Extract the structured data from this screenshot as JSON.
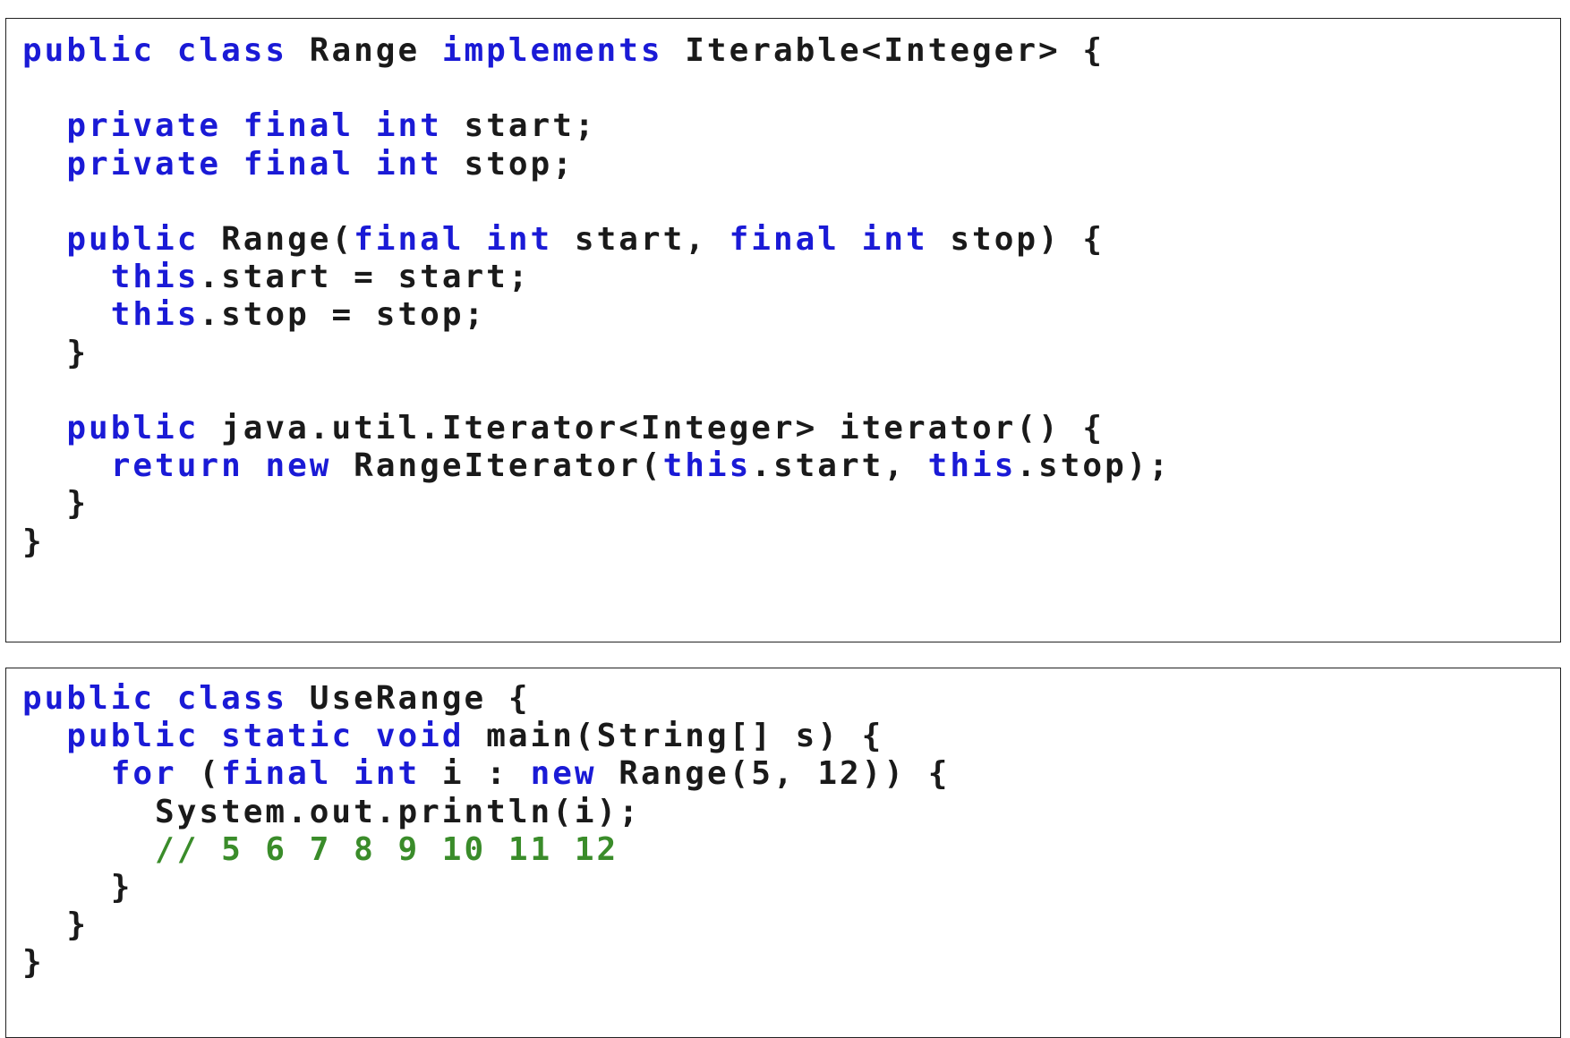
{
  "snippets": [
    {
      "lines": [
        [
          {
            "t": "kw",
            "s": "public"
          },
          {
            "t": "tx",
            "s": " "
          },
          {
            "t": "kw",
            "s": "class"
          },
          {
            "t": "tx",
            "s": " Range "
          },
          {
            "t": "kw",
            "s": "implements"
          },
          {
            "t": "tx",
            "s": " Iterable<Integer> {"
          }
        ],
        [],
        [
          {
            "t": "tx",
            "s": "  "
          },
          {
            "t": "kw",
            "s": "private"
          },
          {
            "t": "tx",
            "s": " "
          },
          {
            "t": "kw",
            "s": "final"
          },
          {
            "t": "tx",
            "s": " "
          },
          {
            "t": "kw",
            "s": "int"
          },
          {
            "t": "tx",
            "s": " start;"
          }
        ],
        [
          {
            "t": "tx",
            "s": "  "
          },
          {
            "t": "kw",
            "s": "private"
          },
          {
            "t": "tx",
            "s": " "
          },
          {
            "t": "kw",
            "s": "final"
          },
          {
            "t": "tx",
            "s": " "
          },
          {
            "t": "kw",
            "s": "int"
          },
          {
            "t": "tx",
            "s": " stop;"
          }
        ],
        [],
        [
          {
            "t": "tx",
            "s": "  "
          },
          {
            "t": "kw",
            "s": "public"
          },
          {
            "t": "tx",
            "s": " Range("
          },
          {
            "t": "kw",
            "s": "final"
          },
          {
            "t": "tx",
            "s": " "
          },
          {
            "t": "kw",
            "s": "int"
          },
          {
            "t": "tx",
            "s": " start, "
          },
          {
            "t": "kw",
            "s": "final"
          },
          {
            "t": "tx",
            "s": " "
          },
          {
            "t": "kw",
            "s": "int"
          },
          {
            "t": "tx",
            "s": " stop) {"
          }
        ],
        [
          {
            "t": "tx",
            "s": "    "
          },
          {
            "t": "kw",
            "s": "this"
          },
          {
            "t": "tx",
            "s": ".start = start;"
          }
        ],
        [
          {
            "t": "tx",
            "s": "    "
          },
          {
            "t": "kw",
            "s": "this"
          },
          {
            "t": "tx",
            "s": ".stop = stop;"
          }
        ],
        [
          {
            "t": "tx",
            "s": "  }"
          }
        ],
        [],
        [
          {
            "t": "tx",
            "s": "  "
          },
          {
            "t": "kw",
            "s": "public"
          },
          {
            "t": "tx",
            "s": " java.util.Iterator<Integer> iterator() {"
          }
        ],
        [
          {
            "t": "tx",
            "s": "    "
          },
          {
            "t": "kw",
            "s": "return"
          },
          {
            "t": "tx",
            "s": " "
          },
          {
            "t": "kw",
            "s": "new"
          },
          {
            "t": "tx",
            "s": " RangeIterator("
          },
          {
            "t": "kw",
            "s": "this"
          },
          {
            "t": "tx",
            "s": ".start, "
          },
          {
            "t": "kw",
            "s": "this"
          },
          {
            "t": "tx",
            "s": ".stop);"
          }
        ],
        [
          {
            "t": "tx",
            "s": "  }"
          }
        ],
        [
          {
            "t": "tx",
            "s": "}"
          }
        ]
      ]
    },
    {
      "lines": [
        [
          {
            "t": "kw",
            "s": "public"
          },
          {
            "t": "tx",
            "s": " "
          },
          {
            "t": "kw",
            "s": "class"
          },
          {
            "t": "tx",
            "s": " UseRange {"
          }
        ],
        [
          {
            "t": "tx",
            "s": "  "
          },
          {
            "t": "kw",
            "s": "public"
          },
          {
            "t": "tx",
            "s": " "
          },
          {
            "t": "kw",
            "s": "static"
          },
          {
            "t": "tx",
            "s": " "
          },
          {
            "t": "kw",
            "s": "void"
          },
          {
            "t": "tx",
            "s": " main(String[] s) {"
          }
        ],
        [
          {
            "t": "tx",
            "s": "    "
          },
          {
            "t": "kw",
            "s": "for"
          },
          {
            "t": "tx",
            "s": " ("
          },
          {
            "t": "kw",
            "s": "final"
          },
          {
            "t": "tx",
            "s": " "
          },
          {
            "t": "kw",
            "s": "int"
          },
          {
            "t": "tx",
            "s": " i : "
          },
          {
            "t": "kw",
            "s": "new"
          },
          {
            "t": "tx",
            "s": " Range(5, 12)) {"
          }
        ],
        [
          {
            "t": "tx",
            "s": "      System.out.println(i);"
          }
        ],
        [
          {
            "t": "tx",
            "s": "      "
          },
          {
            "t": "cm",
            "s": "// 5 6 7 8 9 10 11 12"
          }
        ],
        [
          {
            "t": "tx",
            "s": "    }"
          }
        ],
        [
          {
            "t": "tx",
            "s": "  }"
          }
        ],
        [
          {
            "t": "tx",
            "s": "}"
          }
        ]
      ]
    }
  ],
  "colors": {
    "keyword": "#1a1ad6",
    "comment": "#3a8c2a",
    "text": "#1a1a1a",
    "border": "#222222"
  }
}
